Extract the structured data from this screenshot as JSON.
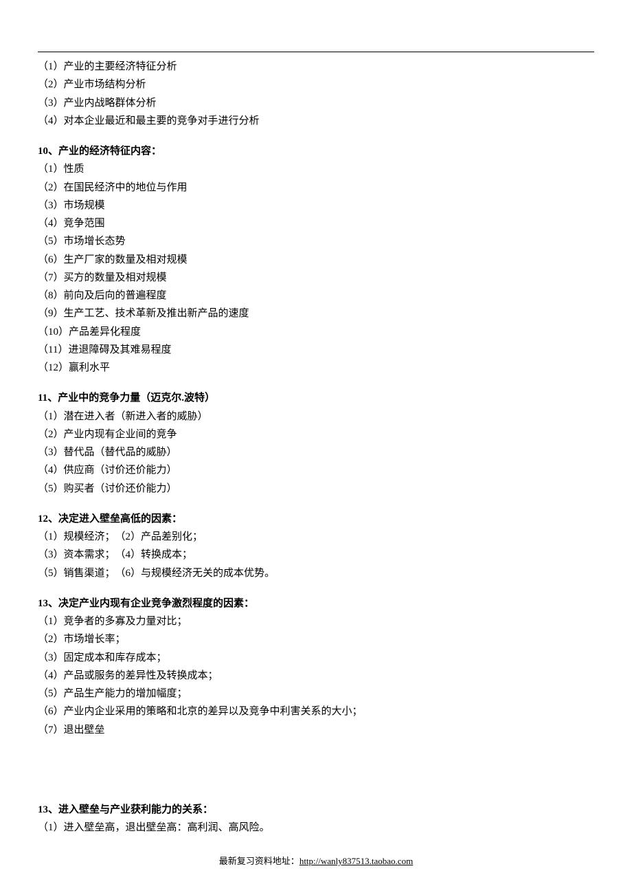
{
  "intro_items": [
    "（1）产业的主要经济特征分析",
    "（2）产业市场结构分析",
    "（3）产业内战略群体分析",
    "（4）对本企业最近和最主要的竞争对手进行分析"
  ],
  "sections": [
    {
      "num": "10",
      "title": "、产业的经济特征内容：",
      "items": [
        "（1）性质",
        "（2）在国民经济中的地位与作用",
        "（3）市场规模",
        "（4）竞争范围",
        "（5）市场增长态势",
        "（6）生产厂家的数量及相对规模",
        "（7）买方的数量及相对规模",
        "（8）前向及后向的普遍程度",
        "（9）生产工艺、技术革新及推出新产品的速度",
        "（10）产品差异化程度",
        "（11）进退障碍及其难易程度",
        "（12）赢利水平"
      ]
    },
    {
      "num": "11",
      "title": "、产业中的竞争力量（迈克尔.波特）",
      "items": [
        "（1）潜在进入者（新进入者的威胁）",
        "（2）产业内现有企业间的竞争",
        "（3）替代品（替代品的威胁）",
        "（4）供应商（讨价还价能力）",
        "（5）购买者（讨价还价能力）"
      ]
    },
    {
      "num": "12",
      "title": "、决定进入壁垒高低的因素：",
      "items": [
        "（1）规模经济；　（2）产品差别化；",
        "（3）资本需求；　（4）转换成本；",
        "（5）销售渠道；　（6）与规模经济无关的成本优势。"
      ]
    },
    {
      "num": "13",
      "title": "、决定产业内现有企业竞争激烈程度的因素：",
      "items": [
        "（1）竞争者的多寡及力量对比；",
        "（2）市场增长率；",
        "（3）固定成本和库存成本；",
        "（4）产品或服务的差异性及转换成本；",
        "（5）产品生产能力的增加幅度；",
        "（6）产业内企业采用的策略和北京的差异以及竞争中利害关系的大小；",
        "（7）退出壁垒"
      ]
    },
    {
      "num": "13",
      "title": "、进入壁垒与产业获利能力的关系：",
      "large_gap": true,
      "items": [
        "（1）进入壁垒高，退出壁垒高：高利润、高风险。"
      ]
    }
  ],
  "footer": {
    "label": "最新复习资料地址：",
    "url": "http://wanly837513.taobao.com"
  }
}
